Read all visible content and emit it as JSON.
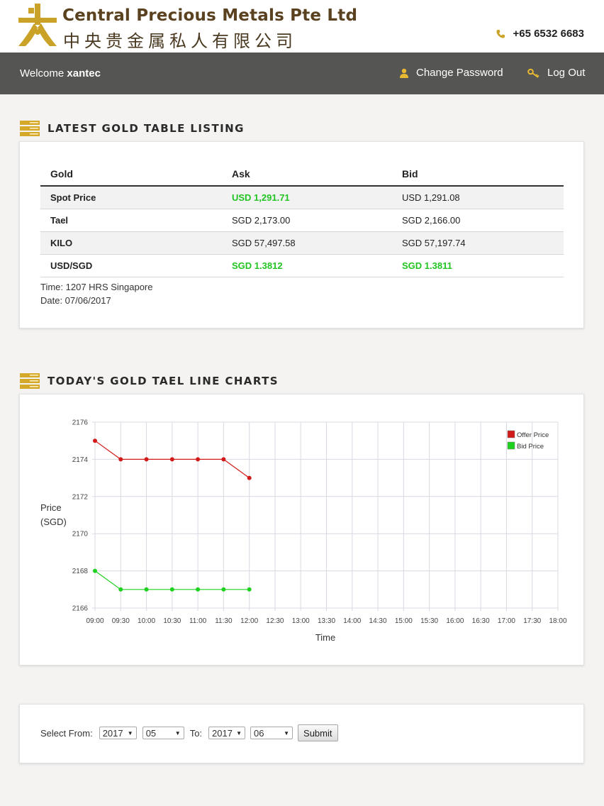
{
  "header": {
    "company_name": "Central Precious Metals Pte Ltd",
    "company_name_chinese": "中央贵金属私人有限公司",
    "phone": "+65 6532 6683",
    "brand_color": "#c9a227"
  },
  "navbar": {
    "welcome_prefix": "Welcome",
    "username": "xantec",
    "change_password_label": "Change Password",
    "logout_label": "Log Out"
  },
  "listing": {
    "heading": "LATEST GOLD TABLE LISTING",
    "columns": [
      "Gold",
      "Ask",
      "Bid"
    ],
    "rows": [
      {
        "label": "Spot Price",
        "ask": "USD 1,291.71",
        "bid": "USD 1,291.08",
        "ask_highlight": true,
        "bid_highlight": false
      },
      {
        "label": "Tael",
        "ask": "SGD 2,173.00",
        "bid": "SGD 2,166.00",
        "ask_highlight": false,
        "bid_highlight": false
      },
      {
        "label": "KILO",
        "ask": "SGD 57,497.58",
        "bid": "SGD 57,197.74",
        "ask_highlight": false,
        "bid_highlight": false
      },
      {
        "label": "USD/SGD",
        "ask": "SGD 1.3812",
        "bid": "SGD 1.3811",
        "ask_highlight": true,
        "bid_highlight": true
      }
    ],
    "time_text": "Time: 1207 HRS Singapore",
    "date_text": "Date: 07/06/2017",
    "highlight_color": "#22c422"
  },
  "chart_section": {
    "heading": "TODAY'S GOLD TAEL LINE CHARTS"
  },
  "chart_data": {
    "type": "line",
    "xlabel": "Time",
    "ylabel_line1": "Price",
    "ylabel_line2": "(SGD)",
    "categories": [
      "09:00",
      "09:30",
      "10:00",
      "10:30",
      "11:00",
      "11:30",
      "12:00",
      "12:30",
      "13:00",
      "13:30",
      "14:00",
      "14:30",
      "15:00",
      "15:30",
      "16:00",
      "16:30",
      "17:00",
      "17:30",
      "18:00"
    ],
    "ylim": [
      2166,
      2176
    ],
    "yticks": [
      2166,
      2168,
      2170,
      2172,
      2174,
      2176
    ],
    "grid": true,
    "legend_position": "top-right",
    "series": [
      {
        "name": "Offer Price",
        "color": "#d11a1a",
        "values": [
          2175,
          2174,
          2174,
          2174,
          2174,
          2174,
          2173
        ]
      },
      {
        "name": "Bid Price",
        "color": "#1fd11f",
        "values": [
          2168,
          2167,
          2167,
          2167,
          2167,
          2167,
          2167
        ]
      }
    ]
  },
  "range_form": {
    "from_label": "Select From:",
    "from_year": "2017",
    "from_month": "05",
    "to_label": "To:",
    "to_year": "2017",
    "to_month": "06",
    "submit_label": "Submit"
  }
}
